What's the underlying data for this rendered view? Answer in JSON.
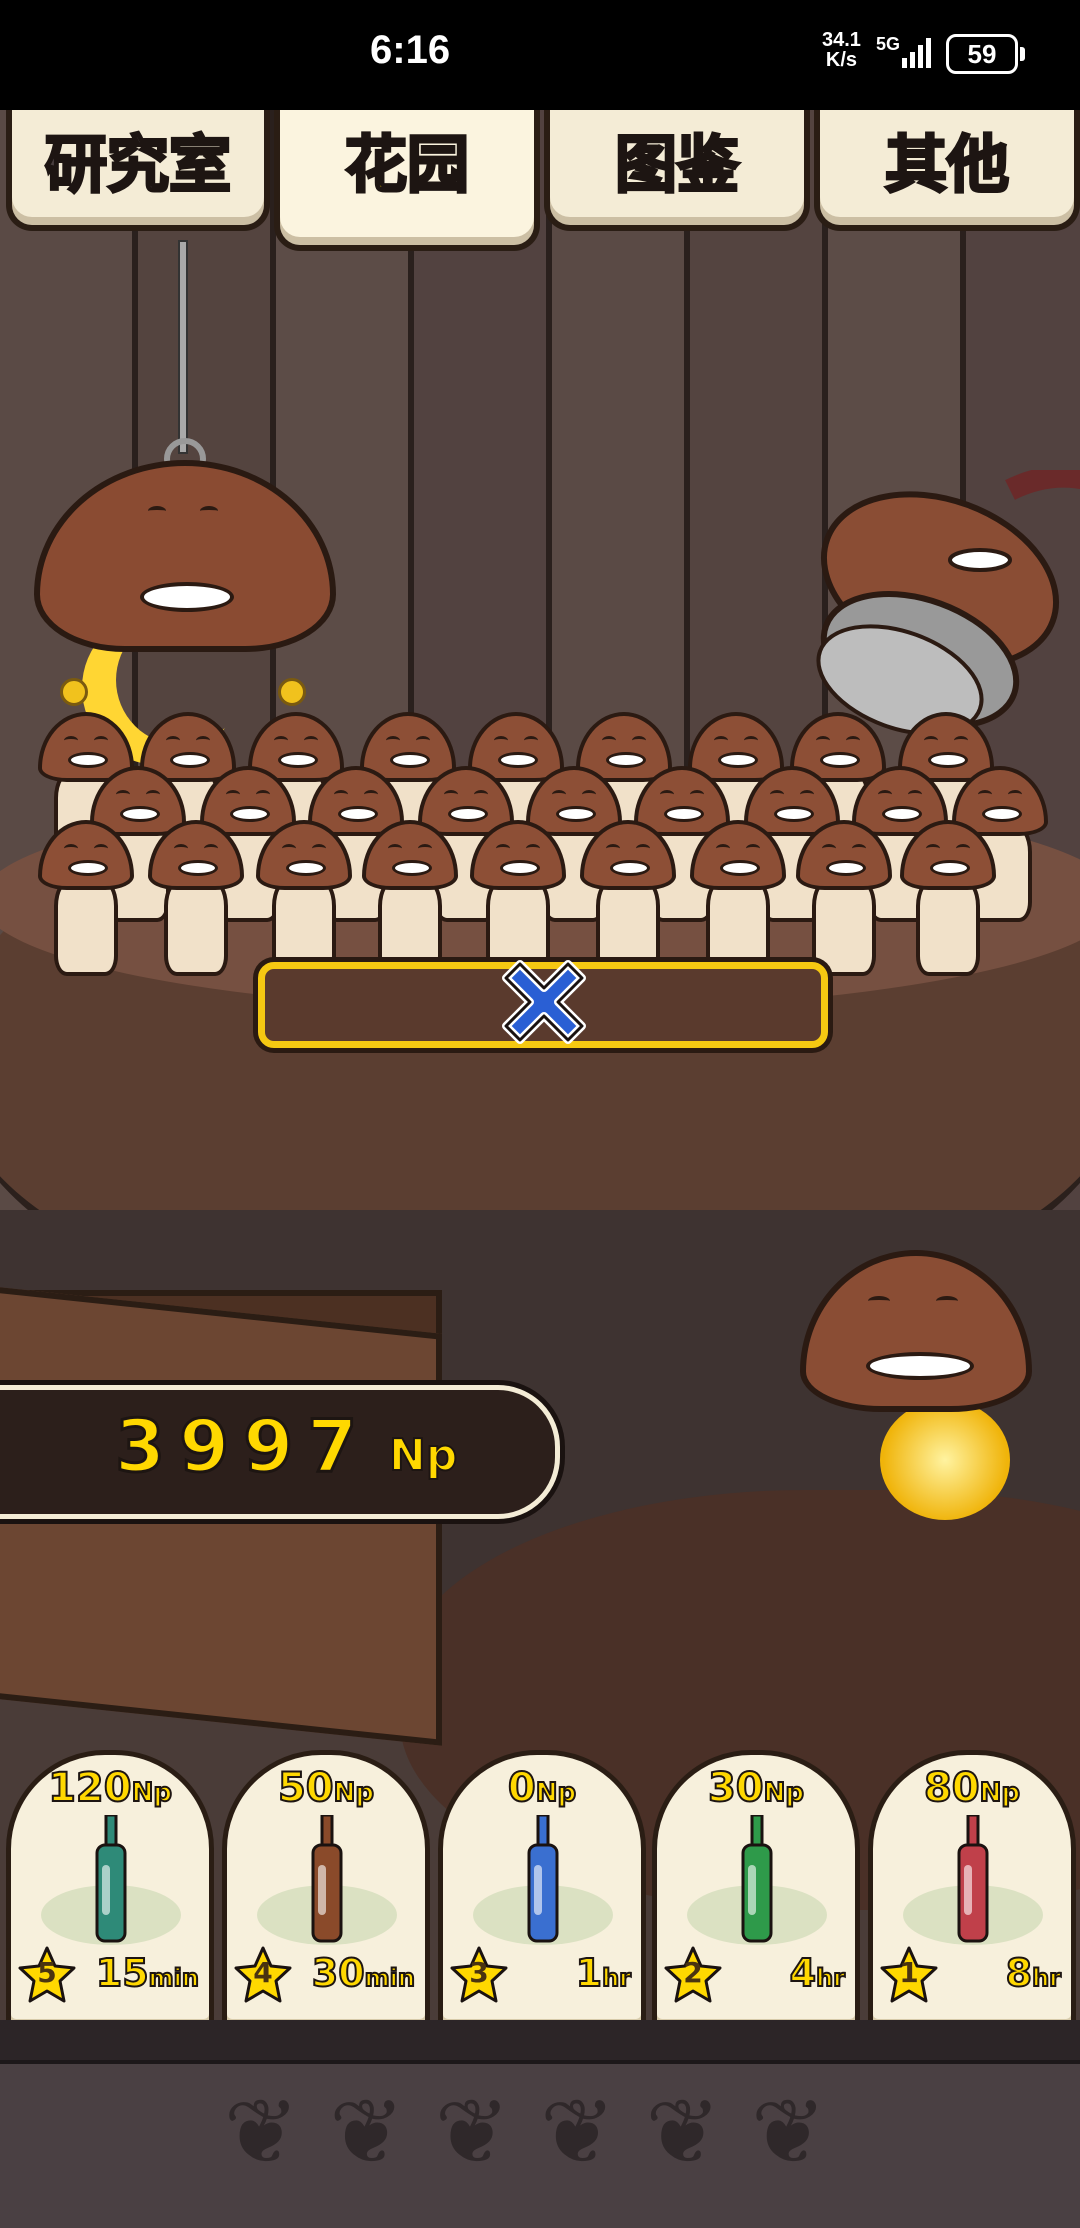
{
  "status_bar": {
    "time": "6:16",
    "net_speed_value": "34.1",
    "net_speed_unit": "K/s",
    "network": "5G",
    "battery": "59"
  },
  "tabs": [
    {
      "label": "研究室",
      "active": false
    },
    {
      "label": "花园",
      "active": true
    },
    {
      "label": "图鉴",
      "active": false
    },
    {
      "label": "其他",
      "active": false
    }
  ],
  "np_counter": {
    "value": "3997",
    "unit": "Np"
  },
  "shop_items": [
    {
      "price": "120",
      "price_unit": "Np",
      "rank": "5",
      "duration": "15",
      "duration_unit": "min",
      "bottle_color": "#2e8a78"
    },
    {
      "price": "50",
      "price_unit": "Np",
      "rank": "4",
      "duration": "30",
      "duration_unit": "min",
      "bottle_color": "#8a4a2a"
    },
    {
      "price": "0",
      "price_unit": "Np",
      "rank": "3",
      "duration": "1",
      "duration_unit": "hr",
      "bottle_color": "#3a6fd0"
    },
    {
      "price": "30",
      "price_unit": "Np",
      "rank": "2",
      "duration": "4",
      "duration_unit": "hr",
      "bottle_color": "#2e9a4a"
    },
    {
      "price": "80",
      "price_unit": "Np",
      "rank": "1",
      "duration": "8",
      "duration_unit": "hr",
      "bottle_color": "#c0404a"
    }
  ],
  "colors": {
    "accent_yellow": "#ffd800",
    "cancel_blue": "#2a5fd4",
    "mushroom_cap": "#8d4f36"
  }
}
